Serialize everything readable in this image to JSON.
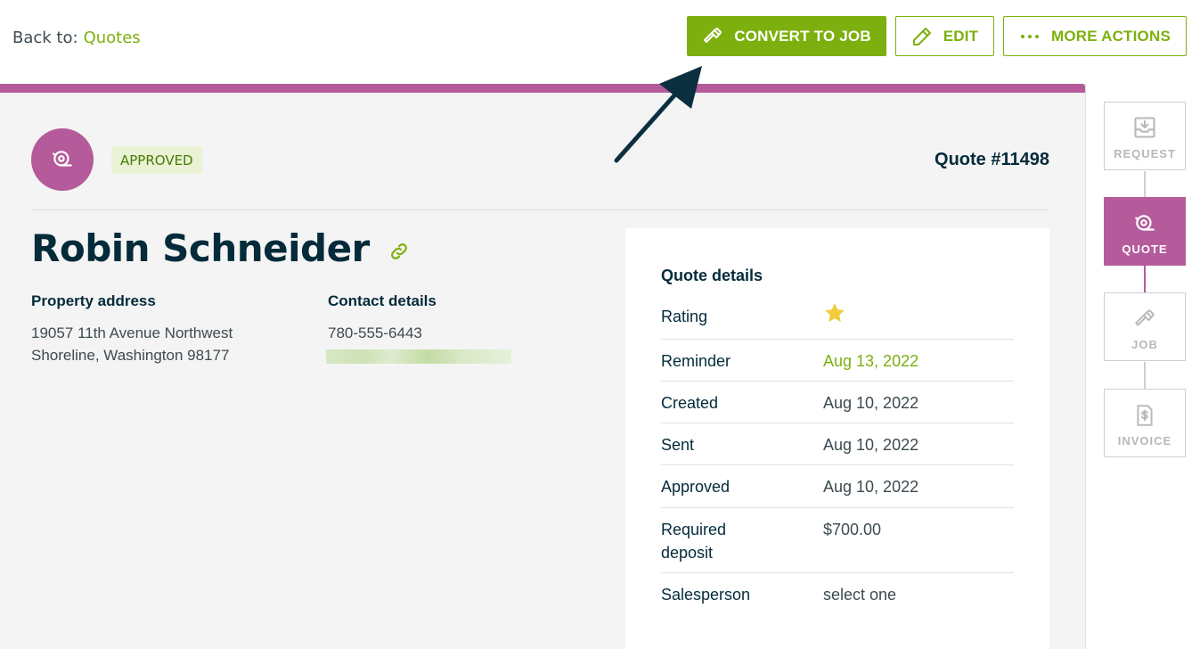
{
  "nav": {
    "back_prefix": "Back to:",
    "back_link": "Quotes"
  },
  "toolbar": {
    "convert_label": "CONVERT TO JOB",
    "edit_label": "EDIT",
    "more_label": "MORE ACTIONS"
  },
  "quote": {
    "status": "APPROVED",
    "number": "Quote #11498"
  },
  "client": {
    "name": "Robin Schneider",
    "property_heading": "Property address",
    "address_line1": "19057 11th Avenue Northwest",
    "address_line2": "Shoreline, Washington 98177",
    "contact_heading": "Contact details",
    "phone": "780-555-6443"
  },
  "details": {
    "title": "Quote details",
    "rows": [
      {
        "label": "Rating",
        "value": ""
      },
      {
        "label": "Reminder",
        "value": "Aug 13, 2022"
      },
      {
        "label": "Created",
        "value": "Aug 10, 2022"
      },
      {
        "label": "Sent",
        "value": "Aug 10, 2022"
      },
      {
        "label": "Approved",
        "value": "Aug 10, 2022"
      },
      {
        "label": "Required deposit",
        "value": "$700.00"
      },
      {
        "label": "Salesperson",
        "value": "select one"
      }
    ],
    "rating_stars": 1
  },
  "workflow": [
    {
      "label": "REQUEST",
      "icon": "inbox-icon",
      "active": false
    },
    {
      "label": "QUOTE",
      "icon": "tape-measure-icon",
      "active": true
    },
    {
      "label": "JOB",
      "icon": "hammer-icon",
      "active": false
    },
    {
      "label": "INVOICE",
      "icon": "invoice-dollar-icon",
      "active": false
    }
  ],
  "colors": {
    "brand_green": "#7db00e",
    "quote_purple": "#b55b9b",
    "text_dark": "#032b3a",
    "annotation_arrow": "#0b2f3f"
  }
}
